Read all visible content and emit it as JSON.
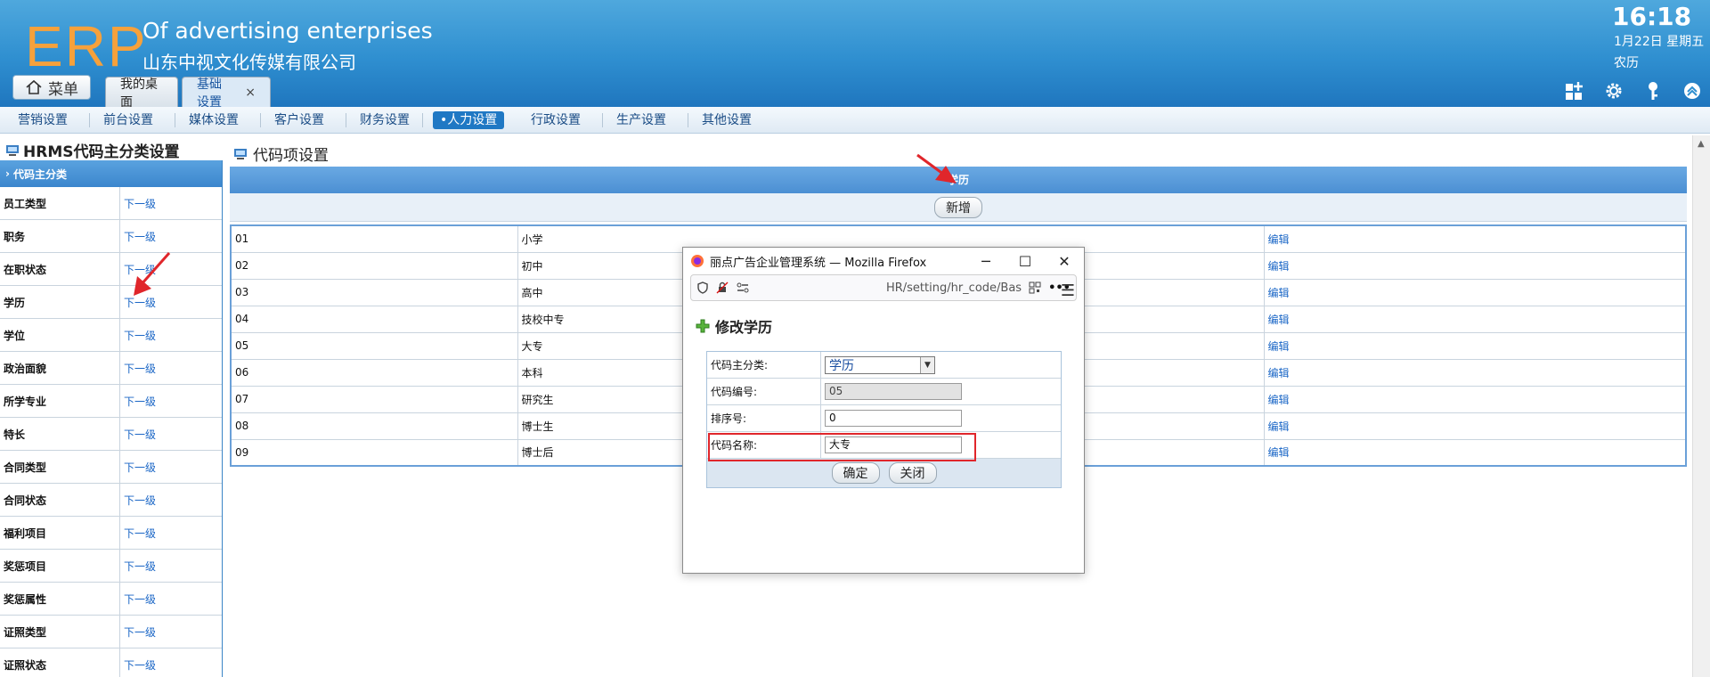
{
  "header": {
    "logo": "ERP",
    "company_en": "Of advertising enterprises",
    "company_cn": "山东中视文化传媒有限公司",
    "menu_label": "菜单",
    "tabs": [
      {
        "label": "我的桌面"
      },
      {
        "label": "基础设置",
        "close": "×"
      }
    ],
    "clock": "16:18",
    "date": "1月22日 星期五",
    "lunar": "农历",
    "icons": [
      "add-widget-icon",
      "gear-icon",
      "key-icon",
      "collapse-icon"
    ]
  },
  "subnav": {
    "items": [
      "营销设置",
      "前台设置",
      "媒体设置",
      "客户设置",
      "财务设置",
      "•人力设置",
      "行政设置",
      "生产设置",
      "其他设置"
    ],
    "active": "•人力设置"
  },
  "left": {
    "title": "HRMS代码主分类设置",
    "header": "代码主分类",
    "link_label": "下一级",
    "rows": [
      "员工类型",
      "职务",
      "在职状态",
      "学历",
      "学位",
      "政治面貌",
      "所学专业",
      "特长",
      "合同类型",
      "合同状态",
      "福利项目",
      "奖惩项目",
      "奖惩属性",
      "证照类型",
      "证照状态"
    ]
  },
  "main": {
    "title": "代码项设置",
    "table_header": "学历",
    "add_button": "新增",
    "edit_label": "编辑",
    "rows": [
      {
        "code": "01",
        "name": "小学"
      },
      {
        "code": "02",
        "name": "初中"
      },
      {
        "code": "03",
        "name": "高中"
      },
      {
        "code": "04",
        "name": "技校中专"
      },
      {
        "code": "05",
        "name": "大专"
      },
      {
        "code": "06",
        "name": "本科"
      },
      {
        "code": "07",
        "name": "研究生"
      },
      {
        "code": "08",
        "name": "博士生"
      },
      {
        "code": "09",
        "name": "博士后"
      }
    ]
  },
  "popup": {
    "window_title": "丽点广告企业管理系统 — Mozilla Firefox",
    "url": "HR/setting/hr_code/Bas",
    "heading": "修改学历",
    "fields": {
      "category_label": "代码主分类:",
      "category_value": "学历",
      "code_label": "代码编号:",
      "code_value": "05",
      "order_label": "排序号:",
      "order_value": "0",
      "name_label": "代码名称:",
      "name_value": "大专"
    },
    "confirm_label": "确定",
    "close_label": "关闭"
  },
  "colors": {
    "header_blue": "#2f8fd0",
    "logo_orange": "#f6a13b",
    "link_blue": "#1a66c6",
    "highlight_red": "#e0262b"
  }
}
